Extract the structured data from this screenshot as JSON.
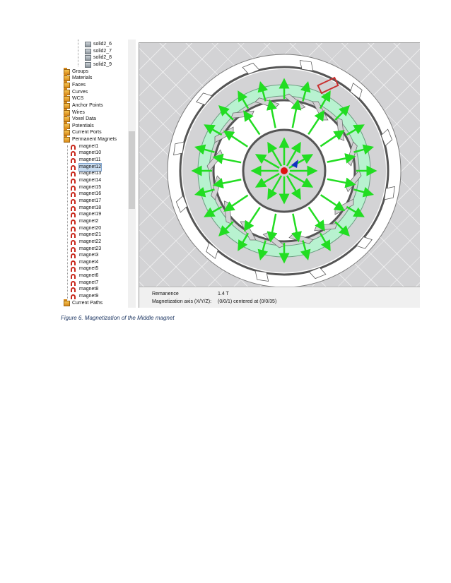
{
  "tree": {
    "items": [
      {
        "label": "solid2_6",
        "icon": "solid-icon",
        "indent": 2
      },
      {
        "label": "solid2_7",
        "icon": "solid-icon",
        "indent": 2
      },
      {
        "label": "solid2_8",
        "icon": "solid-icon",
        "indent": 2
      },
      {
        "label": "solid2_9",
        "icon": "solid-icon",
        "indent": 2
      },
      {
        "label": "Groups",
        "icon": "folder-icon",
        "indent": 0
      },
      {
        "label": "Materials",
        "icon": "folder-icon",
        "indent": 0
      },
      {
        "label": "Faces",
        "icon": "folder-icon",
        "indent": 0
      },
      {
        "label": "Curves",
        "icon": "folder-icon",
        "indent": 0
      },
      {
        "label": "WCS",
        "icon": "folder-icon",
        "indent": 0
      },
      {
        "label": "Anchor Points",
        "icon": "folder-icon",
        "indent": 0
      },
      {
        "label": "Wires",
        "icon": "folder-icon",
        "indent": 0
      },
      {
        "label": "Voxel Data",
        "icon": "folder-icon",
        "indent": 0
      },
      {
        "label": "Potentials",
        "icon": "folder-icon",
        "indent": 0
      },
      {
        "label": "Current Ports",
        "icon": "folder-icon",
        "indent": 0
      },
      {
        "label": "Permanent Magnets",
        "icon": "folder-icon",
        "indent": 0
      },
      {
        "label": "magnet1",
        "icon": "magnet-icon",
        "indent": 1
      },
      {
        "label": "magnet10",
        "icon": "magnet-icon",
        "indent": 1
      },
      {
        "label": "magnet11",
        "icon": "magnet-icon",
        "indent": 1
      },
      {
        "label": "magnet12",
        "icon": "magnet-icon",
        "indent": 1,
        "selected": true
      },
      {
        "label": "magnet13",
        "icon": "magnet-icon",
        "indent": 1
      },
      {
        "label": "magnet14",
        "icon": "magnet-icon",
        "indent": 1
      },
      {
        "label": "magnet15",
        "icon": "magnet-icon",
        "indent": 1
      },
      {
        "label": "magnet16",
        "icon": "magnet-icon",
        "indent": 1
      },
      {
        "label": "magnet17",
        "icon": "magnet-icon",
        "indent": 1
      },
      {
        "label": "magnet18",
        "icon": "magnet-icon",
        "indent": 1
      },
      {
        "label": "magnet19",
        "icon": "magnet-icon",
        "indent": 1
      },
      {
        "label": "magnet2",
        "icon": "magnet-icon",
        "indent": 1
      },
      {
        "label": "magnet20",
        "icon": "magnet-icon",
        "indent": 1
      },
      {
        "label": "magnet21",
        "icon": "magnet-icon",
        "indent": 1
      },
      {
        "label": "magnet22",
        "icon": "magnet-icon",
        "indent": 1
      },
      {
        "label": "magnet23",
        "icon": "magnet-icon",
        "indent": 1
      },
      {
        "label": "magnet3",
        "icon": "magnet-icon",
        "indent": 1
      },
      {
        "label": "magnet4",
        "icon": "magnet-icon",
        "indent": 1
      },
      {
        "label": "magnet5",
        "icon": "magnet-icon",
        "indent": 1
      },
      {
        "label": "magnet6",
        "icon": "magnet-icon",
        "indent": 1
      },
      {
        "label": "magnet7",
        "icon": "magnet-icon",
        "indent": 1
      },
      {
        "label": "magnet8",
        "icon": "magnet-icon",
        "indent": 1
      },
      {
        "label": "magnet9",
        "icon": "magnet-icon",
        "indent": 1
      },
      {
        "label": "Current Paths",
        "icon": "folder-icon",
        "indent": 0
      }
    ]
  },
  "viewport": {
    "colors": {
      "background": "#d3d3d5",
      "ring": "#ffffff",
      "magnet_ring": "#b8f2d0",
      "arrow": "#22dd22",
      "origin": "#e01010",
      "wcs": "#1030c0",
      "selection": "#c83030"
    }
  },
  "properties": {
    "rows": [
      {
        "key": "Remanence",
        "value": "1.4 T"
      },
      {
        "key": "Magnetization axis (X/Y/Z):",
        "value": "(0/0/1) centered at (0/0/35)"
      }
    ]
  },
  "caption": "Figure 6. Magnetization of the Middle magnet"
}
